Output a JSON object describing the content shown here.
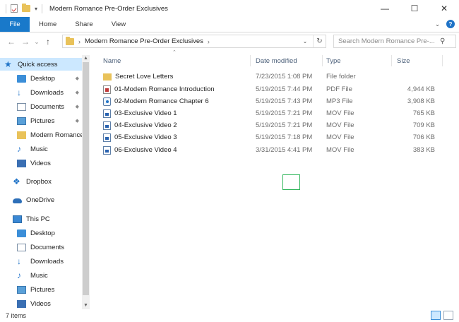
{
  "window": {
    "title": "Modern Romance Pre-Order Exclusives",
    "minimize": "—",
    "maximize": "☐",
    "close": "✕"
  },
  "ribbon": {
    "tabs": [
      "File",
      "Home",
      "Share",
      "View"
    ],
    "expand_icon": "chevron-down-icon",
    "help": "?"
  },
  "address": {
    "back": "←",
    "forward": "→",
    "recent": "⌄",
    "up": "↑",
    "path": "Modern Romance Pre-Order Exclusives",
    "separator": "›",
    "refresh": "↻",
    "search_placeholder": "Search Modern Romance Pre-...",
    "search_icon": "⚲"
  },
  "nav": {
    "items": [
      {
        "label": "Quick access",
        "icon": "star-icon",
        "selected": true
      },
      {
        "label": "Desktop",
        "icon": "desktop-icon",
        "pinned": true
      },
      {
        "label": "Downloads",
        "icon": "download-icon",
        "pinned": true
      },
      {
        "label": "Documents",
        "icon": "documents-icon",
        "pinned": true
      },
      {
        "label": "Pictures",
        "icon": "pictures-icon",
        "pinned": true
      },
      {
        "label": "Modern Romance",
        "icon": "folder-icon"
      },
      {
        "label": "Music",
        "icon": "music-icon"
      },
      {
        "label": "Videos",
        "icon": "videos-icon"
      },
      {
        "label": "Dropbox",
        "icon": "dropbox-icon"
      },
      {
        "label": "OneDrive",
        "icon": "onedrive-icon"
      },
      {
        "label": "This PC",
        "icon": "pc-icon"
      },
      {
        "label": "Desktop",
        "icon": "desktop-icon"
      },
      {
        "label": "Documents",
        "icon": "documents-icon"
      },
      {
        "label": "Downloads",
        "icon": "download-icon"
      },
      {
        "label": "Music",
        "icon": "music-icon"
      },
      {
        "label": "Pictures",
        "icon": "pictures-icon"
      },
      {
        "label": "Videos",
        "icon": "videos-icon"
      }
    ],
    "pin_glyph": "📌"
  },
  "columns": {
    "name": "Name",
    "date": "Date modified",
    "type": "Type",
    "size": "Size"
  },
  "files": [
    {
      "name": "Secret Love Letters",
      "date": "7/23/2015 1:08 PM",
      "type": "File folder",
      "size": "",
      "icon": "folder"
    },
    {
      "name": "01-Modern Romance Introduction",
      "date": "5/19/2015 7:44 PM",
      "type": "PDF File",
      "size": "4,944 KB",
      "icon": "pdf"
    },
    {
      "name": "02-Modern Romance Chapter 6",
      "date": "5/19/2015 7:43 PM",
      "type": "MP3 File",
      "size": "3,908 KB",
      "icon": "mp3"
    },
    {
      "name": "03-Exclusive Video 1",
      "date": "5/19/2015 7:21 PM",
      "type": "MOV File",
      "size": "765 KB",
      "icon": "mov"
    },
    {
      "name": "04-Exclusive Video 2",
      "date": "5/19/2015 7:21 PM",
      "type": "MOV File",
      "size": "709 KB",
      "icon": "mov"
    },
    {
      "name": "05-Exclusive Video 3",
      "date": "5/19/2015 7:18 PM",
      "type": "MOV File",
      "size": "706 KB",
      "icon": "mov"
    },
    {
      "name": "06-Exclusive Video 4",
      "date": "3/31/2015 4:41 PM",
      "type": "MOV File",
      "size": "383 KB",
      "icon": "mov"
    }
  ],
  "status": {
    "item_count": "7 items"
  }
}
